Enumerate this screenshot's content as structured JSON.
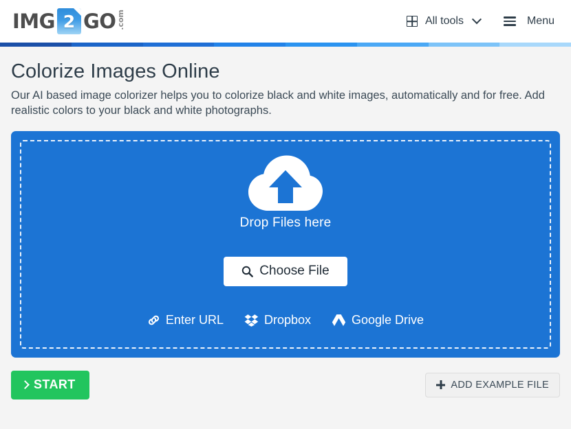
{
  "header": {
    "logo": {
      "word1": "IMG",
      "badge": "2",
      "word2": "GO",
      "tld": ".com"
    },
    "nav": {
      "all_tools_label": "All tools",
      "menu_label": "Menu"
    }
  },
  "stripe_colors": [
    "#1a4fa8",
    "#1a64c8",
    "#1f6fd6",
    "#2182e8",
    "#2a93f0",
    "#4aa8f5",
    "#7cc3f8",
    "#a8d8fb"
  ],
  "main": {
    "title": "Colorize Images Online",
    "description": "Our AI based image colorizer helps you to colorize black and white images, automatically and for free. Add realistic colors to your black and white photographs."
  },
  "dropzone": {
    "drop_text": "Drop Files here",
    "choose_file_label": "Choose File",
    "services": [
      {
        "label": "Enter URL",
        "icon": "link-icon"
      },
      {
        "label": "Dropbox",
        "icon": "dropbox-icon"
      },
      {
        "label": "Google Drive",
        "icon": "google-drive-icon"
      }
    ],
    "background_color": "#1c74d4"
  },
  "actions": {
    "start_label": "START",
    "add_example_label": "ADD EXAMPLE FILE",
    "start_color": "#22c55e"
  }
}
